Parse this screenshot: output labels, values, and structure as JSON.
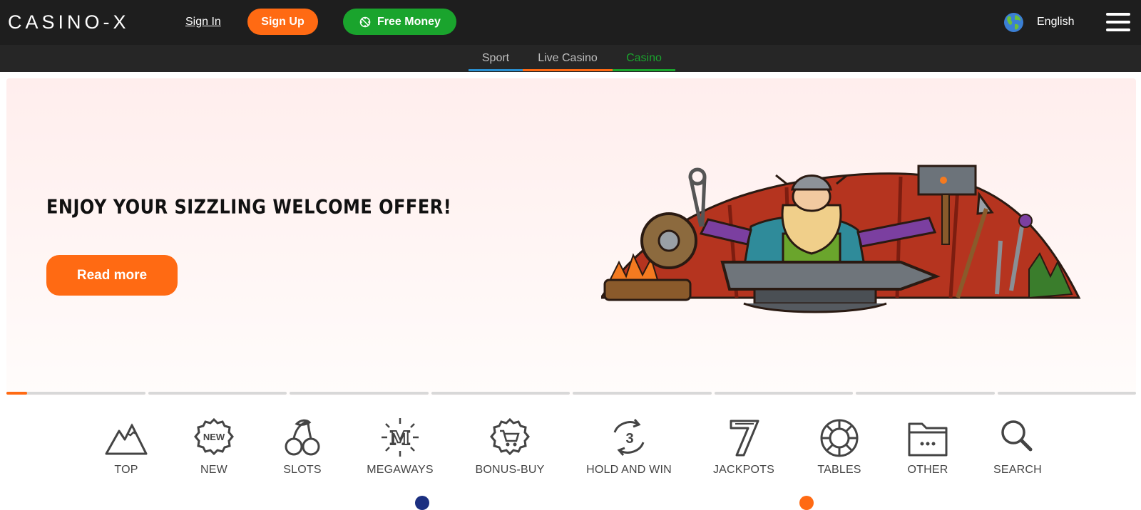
{
  "header": {
    "logo": "CASINO-X",
    "sign_in": "Sign In",
    "sign_up": "Sign Up",
    "free_money": "Free Money",
    "language": "English"
  },
  "subnav": {
    "tabs": [
      {
        "label": "Sport",
        "color": "#2a8fd0"
      },
      {
        "label": "Live Casino",
        "color": "#ff6a13"
      },
      {
        "label": "Casino",
        "color": "#1aa42d",
        "active": true
      }
    ]
  },
  "banner": {
    "headline": "ENJOY YOUR SIZZLING WELCOME OFFER!",
    "cta": "Read more",
    "slides_total": 8,
    "active_slide": 1,
    "active_progress": 0.15
  },
  "categories": [
    {
      "label": "TOP",
      "icon": "mountain-icon"
    },
    {
      "label": "NEW",
      "icon": "new-badge-icon"
    },
    {
      "label": "SLOTS",
      "icon": "cherries-icon"
    },
    {
      "label": "MEGAWAYS",
      "icon": "megaways-icon"
    },
    {
      "label": "BONUS-BUY",
      "icon": "cart-badge-icon"
    },
    {
      "label": "HOLD AND WIN",
      "icon": "hold-and-win-icon"
    },
    {
      "label": "JACKPOTS",
      "icon": "seven-icon"
    },
    {
      "label": "TABLES",
      "icon": "chip-icon"
    },
    {
      "label": "OTHER",
      "icon": "folder-icon"
    },
    {
      "label": "SEARCH",
      "icon": "search-icon"
    }
  ],
  "colors": {
    "topbar": "#1e1e1e",
    "accent_orange": "#ff6a13",
    "accent_green": "#1aa42d",
    "banner_bg": "#ffeeed"
  }
}
